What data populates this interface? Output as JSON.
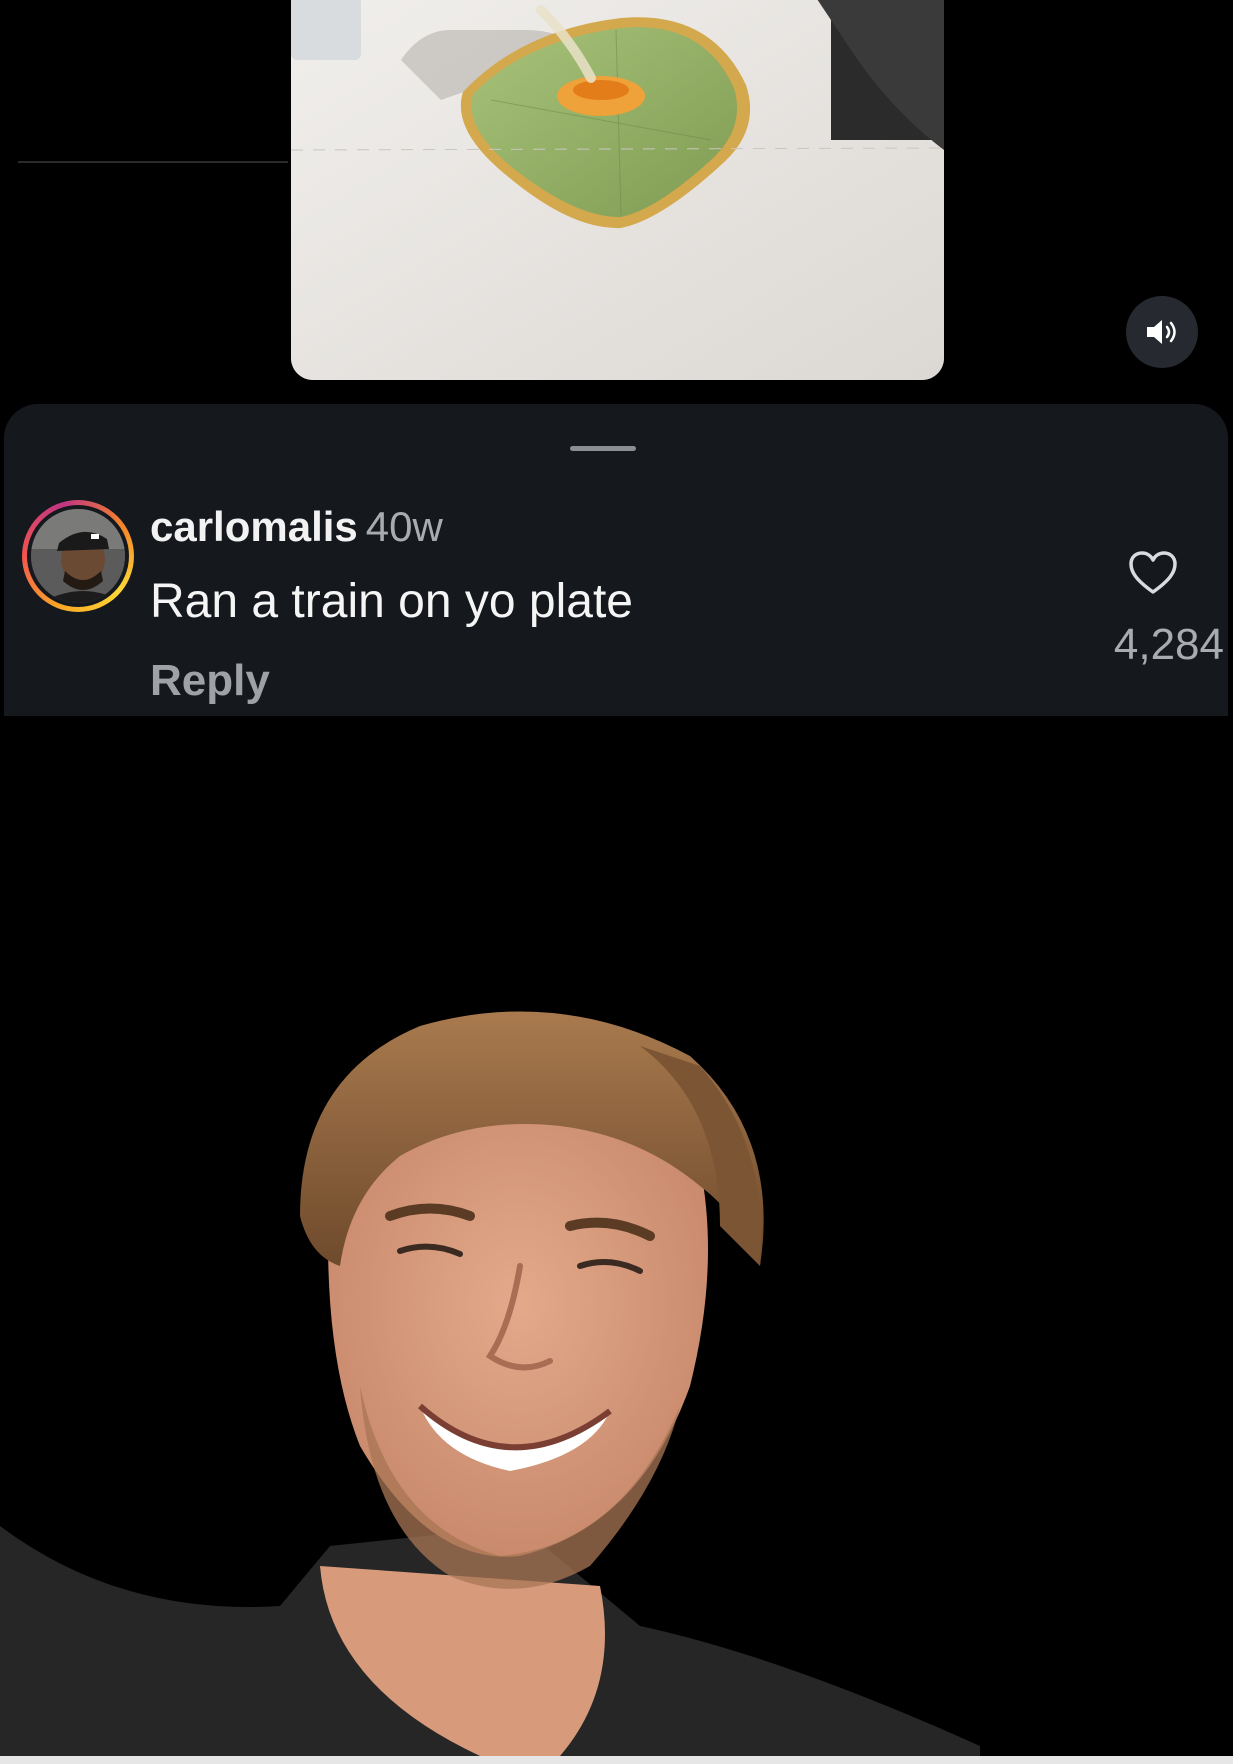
{
  "comment": {
    "username": "carlomalis",
    "time": "40w",
    "text": "Ran a train on yo plate",
    "reply_label": "Reply",
    "likes": "4,284"
  },
  "icons": {
    "sound": "speaker-icon",
    "like": "heart-outline-icon"
  },
  "colors": {
    "sheet_background": "#15191e",
    "secondary_text": "#a8acb0"
  }
}
